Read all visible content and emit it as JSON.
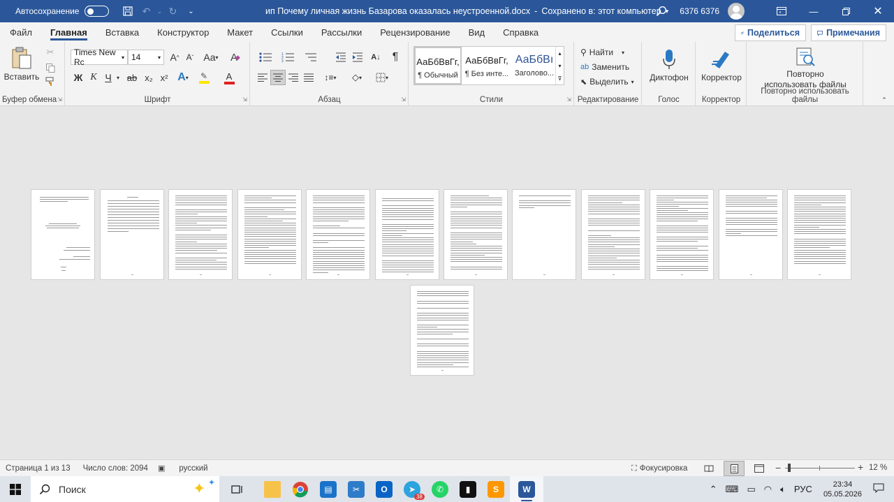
{
  "titlebar": {
    "autosave_label": "Автосохранение",
    "doc_title": "ип Почему личная жизнь Базарова оказалась неустроенной.docx",
    "save_status": "Сохранено в: этот компьютер",
    "user_name": "6376 6376"
  },
  "menu": {
    "tabs": [
      "Файл",
      "Главная",
      "Вставка",
      "Конструктор",
      "Макет",
      "Ссылки",
      "Рассылки",
      "Рецензирование",
      "Вид",
      "Справка"
    ],
    "share_label": "Поделиться",
    "comments_label": "Примечания"
  },
  "ribbon": {
    "clipboard": {
      "paste_label": "Вставить",
      "group_label": "Буфер обмена"
    },
    "font": {
      "font_name": "Times New Rc",
      "font_size": "14",
      "group_label": "Шрифт",
      "bold": "Ж",
      "italic": "К",
      "underline": "Ч",
      "strike": "ab",
      "sub": "x₂",
      "sup": "x²"
    },
    "paragraph": {
      "group_label": "Абзац"
    },
    "styles": {
      "group_label": "Стили",
      "items": [
        {
          "preview": "АаБбВвГг,",
          "name": "¶ Обычный"
        },
        {
          "preview": "АаБбВвГг,",
          "name": "¶ Без инте..."
        },
        {
          "preview": "АаБбВı",
          "name": "Заголово..."
        }
      ]
    },
    "editing": {
      "find": "Найти",
      "replace": "Заменить",
      "select": "Выделить",
      "group_label": "Редактирование"
    },
    "voice": {
      "dictate": "Диктофон",
      "group_label": "Голос"
    },
    "editor": {
      "label": "Корректор",
      "group_label": "Корректор"
    },
    "reuse": {
      "label": "Повторно использовать файлы",
      "group_label": "Повторно использовать файлы"
    }
  },
  "status": {
    "page": "Страница 1 из 13",
    "words": "Число слов: 2094",
    "language": "русский",
    "focus": "Фокусировка",
    "zoom": "12 %"
  },
  "taskbar": {
    "search_label": "Поиск",
    "telegram_badge": "38",
    "tray_lang": "РУС",
    "time": "23:34",
    "date": "05.05.2026"
  },
  "colors": {
    "titlebar": "#2b579a",
    "accent": "#2b579a",
    "highlight_yellow": "#ffe600",
    "font_red": "#e02020"
  }
}
